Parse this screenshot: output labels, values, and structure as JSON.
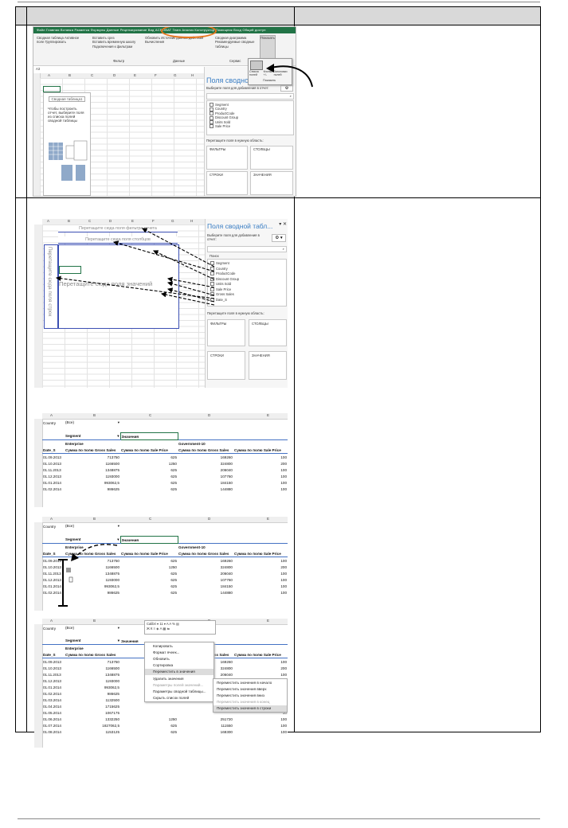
{
  "page": {
    "row_numbers": [
      "1",
      "2"
    ]
  },
  "shot1": {
    "ribbon_tabs": "Файл  Главная  Вставка  Разметка  Формулы  Данные  Рецензирование  Вид  ACROBAT  Team  Анализ  Конструктор  Помощник  Вход  Общий доступ",
    "ribbon_groups": [
      "Сводная таблица",
      "Активное поле",
      "Группировать",
      "Вставить срез",
      "Вставить временную шкалу",
      "Подключения к фильтрам",
      "Обновить",
      "Источник данных",
      "Действия",
      "Вычисления",
      "Сводная диаграмма",
      "Рекомендуемые сводные таблицы",
      "Показать"
    ],
    "group_labels": [
      "Фильтр",
      "Данные",
      "Сервис"
    ],
    "show_buttons": [
      "Список полей",
      "Кнопки +/-",
      "Заголовки полей"
    ],
    "show_group": "Показать",
    "cell_ref": "A3",
    "columns": [
      "A",
      "B",
      "C",
      "D",
      "E",
      "F",
      "G",
      "H",
      "I"
    ],
    "placeholder_title": "Сводная таблица1",
    "placeholder_text": "Чтобы построить отчет, выберите поля из списка полей сводной таблицы",
    "pane_title": "Поля сводной та",
    "pane_prompt": "Выберите поля для добавления в отчет:",
    "search": "Поиск",
    "fields": [
      "Segment",
      "Country",
      "ProductCode",
      "Discount Group",
      "Units Sold",
      "Sale Price"
    ],
    "drag_prompt": "Перетащите поля в нужную область:",
    "areas": [
      "ФИЛЬТРЫ",
      "СТОЛБЦЫ",
      "СТРОКИ",
      "ЗНАЧЕНИЯ"
    ]
  },
  "shot2": {
    "columns": [
      "A",
      "B",
      "C",
      "D",
      "E",
      "F",
      "G",
      "H"
    ],
    "drop_filter": "Перетащите сюда поля фильтра отчета",
    "drop_columns": "Перетащите сюда поля столбцов",
    "drop_rows": "Перетащите сюда поля строк",
    "drop_values": "Перетащите сюда поля значений",
    "pane_title": "Поля сводной табл...",
    "pane_prompt": "Выберите поля для добавления в отчет:",
    "search": "Поиск",
    "fields": [
      "Segment",
      "Country",
      "ProductCode",
      "Discount Group",
      "Units Sold",
      "Sale Price",
      "Gross Sales",
      "Date_S"
    ],
    "drag_prompt": "Перетащите поля в нужную область:",
    "areas": [
      "ФИЛЬТРЫ",
      "СТОЛБЦЫ",
      "СТРОКИ",
      "ЗНАЧЕНИЯ"
    ]
  },
  "pivot": {
    "columns": [
      "A",
      "B",
      "C",
      "D",
      "E"
    ],
    "filter_label": "Country",
    "filter_value": "(Все)",
    "segment_label": "Segment",
    "values_label": "Значения",
    "seg1": "Enterprise",
    "seg2": "Government-10",
    "row_field": "Date_S",
    "h_gross": "Сумма по полю Gross Sales",
    "h_price": "Сумма по полю Sale Price",
    "rows": [
      [
        "01.09.2013",
        "713750",
        "625",
        "169260",
        "100"
      ],
      [
        "01.10.2013",
        "1166500",
        "1250",
        "324800",
        "200"
      ],
      [
        "01.11.2013",
        "1348875",
        "625",
        "206040",
        "100"
      ],
      [
        "01.12.2013",
        "1193000",
        "625",
        "107760",
        "100"
      ],
      [
        "01.01.2014",
        "993062,5",
        "625",
        "184150",
        "100"
      ],
      [
        "01.02.2014",
        "986625",
        "625",
        "144880",
        "100"
      ]
    ]
  },
  "shot5": {
    "font": "Calibri",
    "size": "11",
    "extra_rows": [
      [
        "01.03.2014",
        "1132500",
        "625",
        "30"
      ],
      [
        "01.04.2014",
        "1715625",
        "625",
        "30"
      ],
      [
        "01.05.2014",
        "1067175",
        "625",
        "30"
      ],
      [
        "01.06.2014",
        "1332250",
        "1250",
        "251720"
      ],
      [
        "01.07.2014",
        "1827062,5",
        "625",
        "111550"
      ],
      [
        "01.08.2014",
        "1153125",
        "625",
        "168300"
      ]
    ],
    "menu": [
      "Копировать",
      "Формат ячеек...",
      "Обновить",
      "Сортировка",
      "Переместить в значения",
      "Удалить значения",
      "Параметры полей значений...",
      "Параметры сводной таблицы...",
      "Скрыть список полей"
    ],
    "submenu": [
      "Переместить значения в начало",
      "Переместить значения вверх",
      "Переместить значения вниз",
      "Переместить значения в конец",
      "Переместить значения в строки"
    ]
  },
  "colors": {
    "ribbon_green": "#217346",
    "highlight_orange": "#e8751a",
    "pivot_blue": "#4472c4",
    "pane_title": "#3a7ec4"
  }
}
